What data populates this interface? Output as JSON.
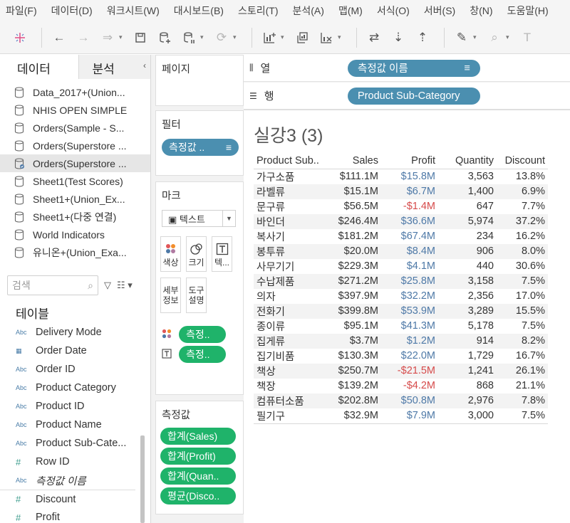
{
  "menu": [
    "파일(F)",
    "데이터(D)",
    "워크시트(W)",
    "대시보드(B)",
    "스토리(T)",
    "분석(A)",
    "맵(M)",
    "서식(O)",
    "서버(S)",
    "창(N)",
    "도움말(H)"
  ],
  "toolbar_icons": [
    "tableau-logo-icon",
    "undo-icon",
    "redo-icon",
    "replay-icon",
    "save-icon",
    "new-datasource-icon",
    "pause-icon",
    "refresh-icon",
    "new-worksheet-icon",
    "duplicate-icon",
    "clear-sheet-icon",
    "swap-icon",
    "sort-ascending-icon",
    "sort-descending-icon",
    "highlight-icon",
    "attach-icon",
    "text-label-icon"
  ],
  "data_pane": {
    "tab_data": "데이터",
    "tab_analysis": "분석",
    "datasources": [
      {
        "label": "Data_2017+(Union...",
        "selected": false
      },
      {
        "label": "NHIS OPEN SIMPLE",
        "selected": false
      },
      {
        "label": "Orders(Sample - S...",
        "selected": false
      },
      {
        "label": "Orders(Superstore ...",
        "selected": false
      },
      {
        "label": "Orders(Superstore ...",
        "selected": true
      },
      {
        "label": "Sheet1(Test Scores)",
        "selected": false
      },
      {
        "label": "Sheet1+(Union_Ex...",
        "selected": false
      },
      {
        "label": "Sheet1+(다중 연결)",
        "selected": false
      },
      {
        "label": "World Indicators",
        "selected": false
      },
      {
        "label": "유니온+(Union_Exa...",
        "selected": false
      }
    ],
    "search_placeholder": "검색",
    "table_heading": "테이블",
    "fields": [
      {
        "type": "Abc",
        "label": "Delivery Mode"
      },
      {
        "type": "date",
        "label": "Order Date"
      },
      {
        "type": "Abc",
        "label": "Order ID"
      },
      {
        "type": "Abc",
        "label": "Product Category"
      },
      {
        "type": "Abc",
        "label": "Product ID"
      },
      {
        "type": "Abc",
        "label": "Product Name"
      },
      {
        "type": "Abc",
        "label": "Product Sub-Cate..."
      },
      {
        "type": "#",
        "label": "Row ID"
      },
      {
        "type": "Abc",
        "label": "측정값 이름",
        "italic": true
      },
      {
        "type": "#",
        "label": "Discount"
      },
      {
        "type": "#",
        "label": "Profit"
      }
    ]
  },
  "shelves": {
    "pages_title": "페이지",
    "filters_title": "필터",
    "filter_pill": "측정값 ..",
    "marks_title": "마크",
    "marks_type": "텍스트",
    "mark_buttons": [
      {
        "icon": "color-icon",
        "label": "색상"
      },
      {
        "icon": "size-icon",
        "label": "크기"
      },
      {
        "icon": "text-icon",
        "label": "텍..."
      },
      {
        "icon": "",
        "label": "세부\n정보"
      },
      {
        "icon": "",
        "label": "도구\n설명"
      }
    ],
    "mark_pills": [
      {
        "icon": "color-dots-icon",
        "label": "측정.."
      },
      {
        "icon": "text-icon",
        "label": "측정.."
      }
    ],
    "measure_values_title": "측정값",
    "measure_values": [
      "합계(Sales)",
      "합계(Profit)",
      "합계(Quan..",
      "평균(Disco.."
    ]
  },
  "columns_shelf": {
    "label": "열",
    "pill": "측정값 이름"
  },
  "rows_shelf": {
    "label": "행",
    "pill": "Product Sub-Category"
  },
  "viz": {
    "title": "실강3 (3)",
    "headers": [
      "Product Sub..",
      "Sales",
      "Profit",
      "Quantity",
      "Discount"
    ],
    "rows": [
      {
        "cat": "가구소품",
        "sales": "$111.1M",
        "profit": "$15.8M",
        "qty": "3,563",
        "disc": "13.8%"
      },
      {
        "cat": "라벨류",
        "sales": "$15.1M",
        "profit": "$6.7M",
        "qty": "1,400",
        "disc": "6.9%"
      },
      {
        "cat": "문구류",
        "sales": "$56.5M",
        "profit": "-$1.4M",
        "qty": "647",
        "disc": "7.7%"
      },
      {
        "cat": "바인더",
        "sales": "$246.4M",
        "profit": "$36.6M",
        "qty": "5,974",
        "disc": "37.2%"
      },
      {
        "cat": "복사기",
        "sales": "$181.2M",
        "profit": "$67.4M",
        "qty": "234",
        "disc": "16.2%"
      },
      {
        "cat": "봉투류",
        "sales": "$20.0M",
        "profit": "$8.4M",
        "qty": "906",
        "disc": "8.0%"
      },
      {
        "cat": "사무기기",
        "sales": "$229.3M",
        "profit": "$4.1M",
        "qty": "440",
        "disc": "30.6%"
      },
      {
        "cat": "수납제품",
        "sales": "$271.2M",
        "profit": "$25.8M",
        "qty": "3,158",
        "disc": "7.5%"
      },
      {
        "cat": "의자",
        "sales": "$397.9M",
        "profit": "$32.2M",
        "qty": "2,356",
        "disc": "17.0%"
      },
      {
        "cat": "전화기",
        "sales": "$399.8M",
        "profit": "$53.9M",
        "qty": "3,289",
        "disc": "15.5%"
      },
      {
        "cat": "종이류",
        "sales": "$95.1M",
        "profit": "$41.3M",
        "qty": "5,178",
        "disc": "7.5%"
      },
      {
        "cat": "집게류",
        "sales": "$3.7M",
        "profit": "$1.2M",
        "qty": "914",
        "disc": "8.2%"
      },
      {
        "cat": "집기비품",
        "sales": "$130.3M",
        "profit": "$22.0M",
        "qty": "1,729",
        "disc": "16.7%"
      },
      {
        "cat": "책상",
        "sales": "$250.7M",
        "profit": "-$21.5M",
        "qty": "1,241",
        "disc": "26.1%"
      },
      {
        "cat": "책장",
        "sales": "$139.2M",
        "profit": "-$4.2M",
        "qty": "868",
        "disc": "21.1%"
      },
      {
        "cat": "컴퓨터소품",
        "sales": "$202.8M",
        "profit": "$50.8M",
        "qty": "2,976",
        "disc": "7.8%"
      },
      {
        "cat": "필기구",
        "sales": "$32.9M",
        "profit": "$7.9M",
        "qty": "3,000",
        "disc": "7.5%"
      }
    ]
  },
  "colors": {
    "pill_green": "#1fb36a",
    "pill_blue": "#4b8fb0",
    "profit_pos": "#4e79a7",
    "profit_neg": "#d64b4b"
  }
}
